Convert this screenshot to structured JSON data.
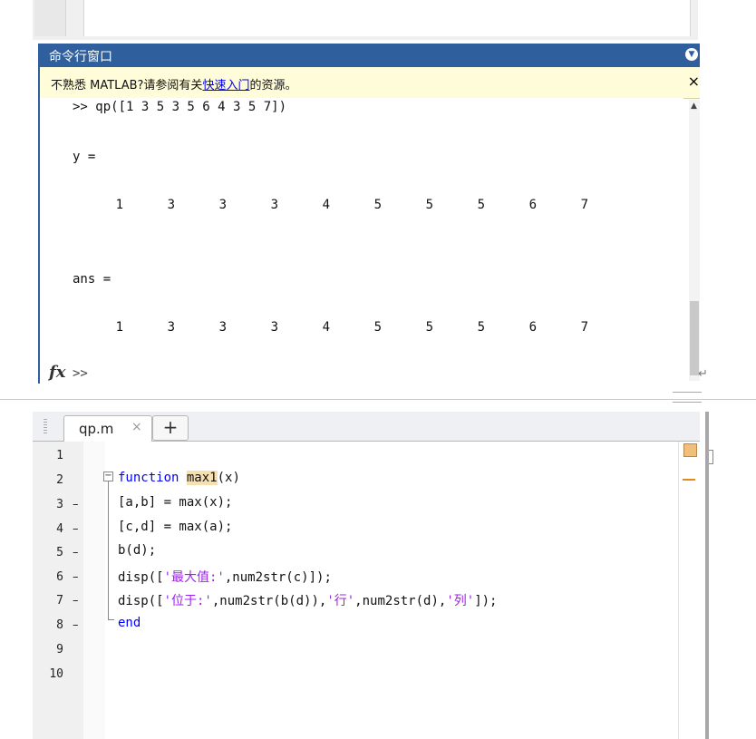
{
  "command_window": {
    "title": "命令行窗口",
    "notice": {
      "prefix": "不熟悉 MATLAB?请参阅有关",
      "link": "快速入门",
      "suffix": "的资源。",
      "close": "×"
    },
    "input_line": ">> qp([1 3 5 3 5 6 4 3 5 7])",
    "output_1_label": "y =",
    "output_1_values": [
      "1",
      "3",
      "3",
      "3",
      "4",
      "5",
      "5",
      "5",
      "6",
      "7"
    ],
    "output_2_label": "ans =",
    "output_2_values": [
      "1",
      "3",
      "3",
      "3",
      "4",
      "5",
      "5",
      "5",
      "6",
      "7"
    ],
    "fx_label": "fx",
    "prompt": ">>"
  },
  "editor": {
    "tab_label": "qp.m",
    "tab_close": "×",
    "tab_add": "+",
    "line_numbers": [
      "1",
      "2",
      "3",
      "4",
      "5",
      "6",
      "7",
      "8",
      "9",
      "10"
    ],
    "breakpoint_dashes": [
      "",
      "",
      "–",
      "–",
      "–",
      "–",
      "–",
      "–",
      "",
      ""
    ],
    "code": {
      "l2_kw": "function",
      "l2_name": "max1",
      "l2_args": "(x)",
      "l3": "[a,b] = max(x);",
      "l4": "[c,d] = max(a);",
      "l5": "b(d);",
      "l6_a": "disp([",
      "l6_str": "'最大值:'",
      "l6_b": ",num2str(c)]);",
      "l7_a": "disp([",
      "l7_str1": "'位于:'",
      "l7_b": ",num2str(b(d)),",
      "l7_str2": "'行'",
      "l7_c": ",num2str(d),",
      "l7_str3": "'列'",
      "l7_d": "]);",
      "l8_kw": "end"
    }
  },
  "colors": {
    "titlebar": "#2f5f9c",
    "notice_bg": "#fffcd9",
    "keyword": "#0000ff",
    "string": "#a020f0",
    "highlight": "#f6dfb0"
  }
}
